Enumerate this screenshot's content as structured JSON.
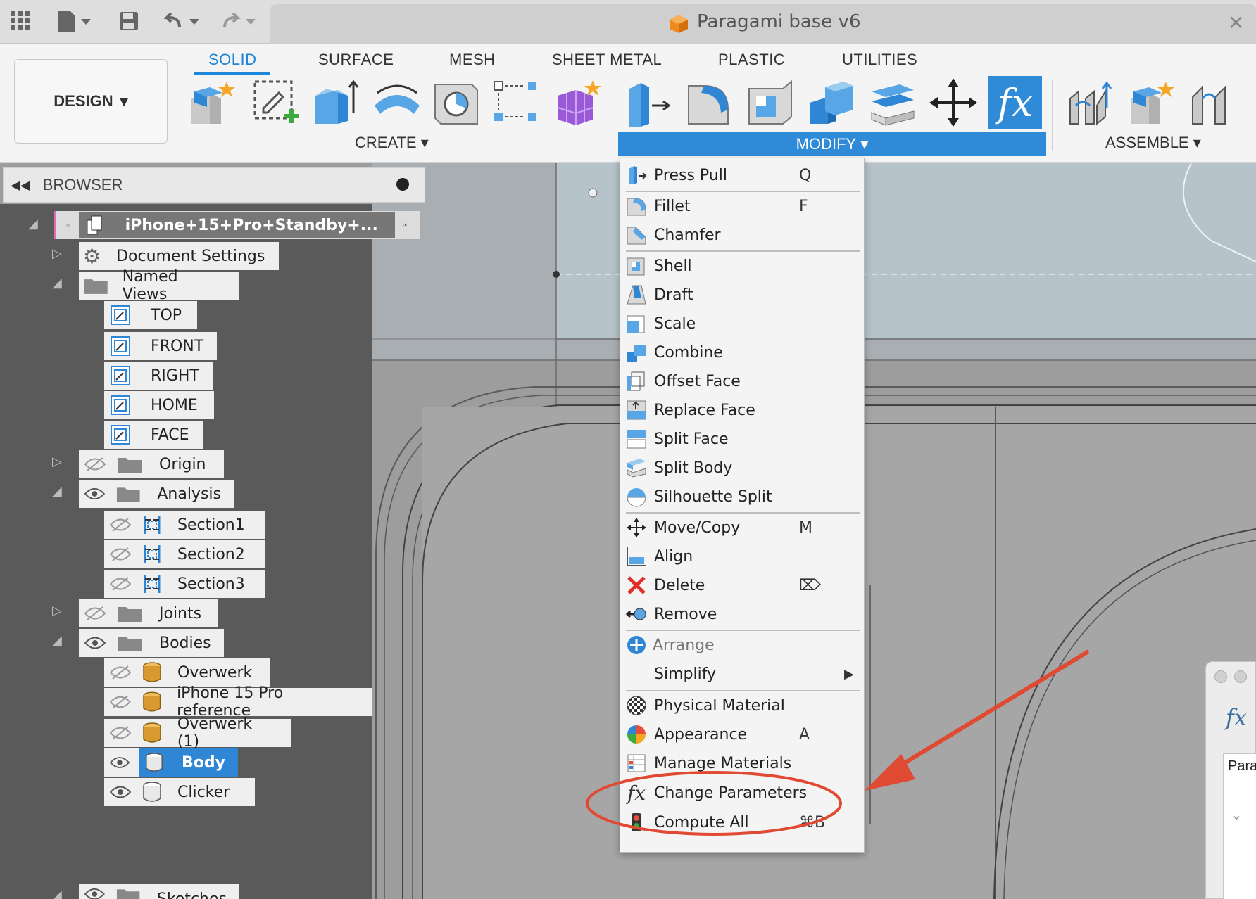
{
  "titlebar": {
    "document_title": "Paragami base v6",
    "close_symbol": "✕"
  },
  "toolbar": {
    "workspace_label": "DESIGN",
    "tabs": [
      "SOLID",
      "SURFACE",
      "MESH",
      "SHEET METAL",
      "PLASTIC",
      "UTILITIES"
    ],
    "groups": {
      "create": "CREATE",
      "modify": "MODIFY",
      "assemble": "ASSEMBLE"
    },
    "fx_glyph": "fx"
  },
  "browser": {
    "title": "BROWSER",
    "root": "iPhone+15+Pro+Standby+...",
    "items": {
      "document_settings": "Document Settings",
      "named_views": "Named Views",
      "views": [
        "TOP",
        "FRONT",
        "RIGHT",
        "HOME",
        "FACE"
      ],
      "origin": "Origin",
      "analysis": "Analysis",
      "sections": [
        "Section1",
        "Section2",
        "Section3"
      ],
      "joints": "Joints",
      "bodies": "Bodies",
      "body_items": [
        "Overwerk",
        "iPhone 15 Pro reference",
        "Overwerk (1)",
        "Body",
        "Clicker"
      ],
      "sketches": "Sketches"
    }
  },
  "modify_menu": {
    "items": [
      {
        "label": "Press Pull",
        "shortcut": "Q"
      },
      {
        "label": "Fillet",
        "shortcut": "F"
      },
      {
        "label": "Chamfer",
        "shortcut": ""
      },
      {
        "label": "Shell",
        "shortcut": ""
      },
      {
        "label": "Draft",
        "shortcut": ""
      },
      {
        "label": "Scale",
        "shortcut": ""
      },
      {
        "label": "Combine",
        "shortcut": ""
      },
      {
        "label": "Offset Face",
        "shortcut": ""
      },
      {
        "label": "Replace Face",
        "shortcut": ""
      },
      {
        "label": "Split Face",
        "shortcut": ""
      },
      {
        "label": "Split Body",
        "shortcut": ""
      },
      {
        "label": "Silhouette Split",
        "shortcut": ""
      },
      {
        "label": "Move/Copy",
        "shortcut": "M"
      },
      {
        "label": "Align",
        "shortcut": ""
      },
      {
        "label": "Delete",
        "shortcut": "⌦"
      },
      {
        "label": "Remove",
        "shortcut": ""
      },
      {
        "label": "Arrange",
        "shortcut": ""
      },
      {
        "label": "Simplify",
        "shortcut": "▶"
      },
      {
        "label": "Physical Material",
        "shortcut": ""
      },
      {
        "label": "Appearance",
        "shortcut": "A"
      },
      {
        "label": "Manage Materials",
        "shortcut": ""
      },
      {
        "label": "Change Parameters",
        "shortcut": ""
      },
      {
        "label": "Compute All",
        "shortcut": "⌘B"
      }
    ]
  },
  "dialog": {
    "fx_glyph": "fx",
    "column_fragment": "Para"
  },
  "colors": {
    "accent": "#2f8ad8",
    "annotation": "#e04a32",
    "selection": "#2f86d5"
  }
}
